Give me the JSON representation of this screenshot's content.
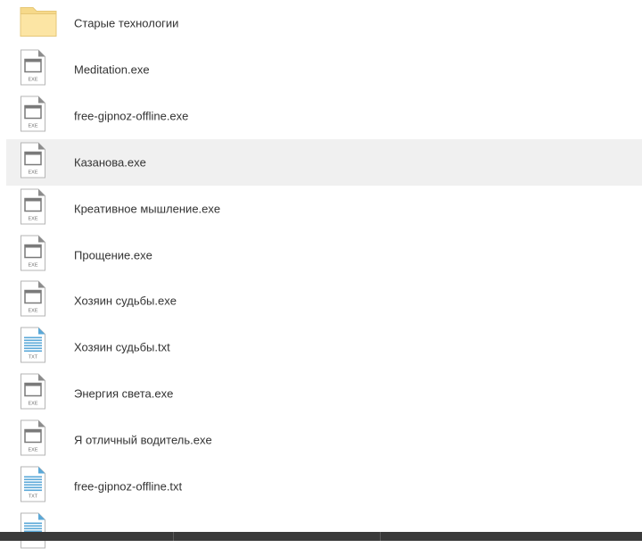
{
  "files": [
    {
      "name": "Старые технологии",
      "type": "folder",
      "selected": false,
      "icon": "folder-icon"
    },
    {
      "name": "Meditation.exe",
      "type": "exe",
      "badge": "EXE",
      "selected": false,
      "icon": "exe-file-icon"
    },
    {
      "name": "free-gipnoz-offline.exe",
      "type": "exe",
      "badge": "EXE",
      "selected": false,
      "icon": "exe-file-icon"
    },
    {
      "name": "Казанова.exe",
      "type": "exe",
      "badge": "EXE",
      "selected": true,
      "icon": "exe-file-icon"
    },
    {
      "name": "Креативное мышление.exe",
      "type": "exe",
      "badge": "EXE",
      "selected": false,
      "icon": "exe-file-icon"
    },
    {
      "name": "Прощение.exe",
      "type": "exe",
      "badge": "EXE",
      "selected": false,
      "icon": "exe-file-icon"
    },
    {
      "name": "Хозяин судьбы.exe",
      "type": "exe",
      "badge": "EXE",
      "selected": false,
      "icon": "exe-file-icon"
    },
    {
      "name": "Хозяин судьбы.txt",
      "type": "txt",
      "badge": "TXT",
      "selected": false,
      "icon": "txt-file-icon"
    },
    {
      "name": "Энергия света.exe",
      "type": "exe",
      "badge": "EXE",
      "selected": false,
      "icon": "exe-file-icon"
    },
    {
      "name": "Я отличный водитель.exe",
      "type": "exe",
      "badge": "EXE",
      "selected": false,
      "icon": "exe-file-icon"
    },
    {
      "name": "free-gipnoz-offline.txt",
      "type": "txt",
      "badge": "TXT",
      "selected": false,
      "icon": "txt-file-icon"
    },
    {
      "name": "",
      "type": "txt",
      "badge": "",
      "selected": false,
      "icon": "txt-file-icon"
    }
  ],
  "colors": {
    "folder": "#fce5a4",
    "folder_tab": "#f6d98a",
    "selected_row": "#f0f0f0",
    "txt_lines": "#5aa8d8",
    "icon_stroke": "#b5b5b5",
    "bottom_bar": "#3a3a3a"
  }
}
